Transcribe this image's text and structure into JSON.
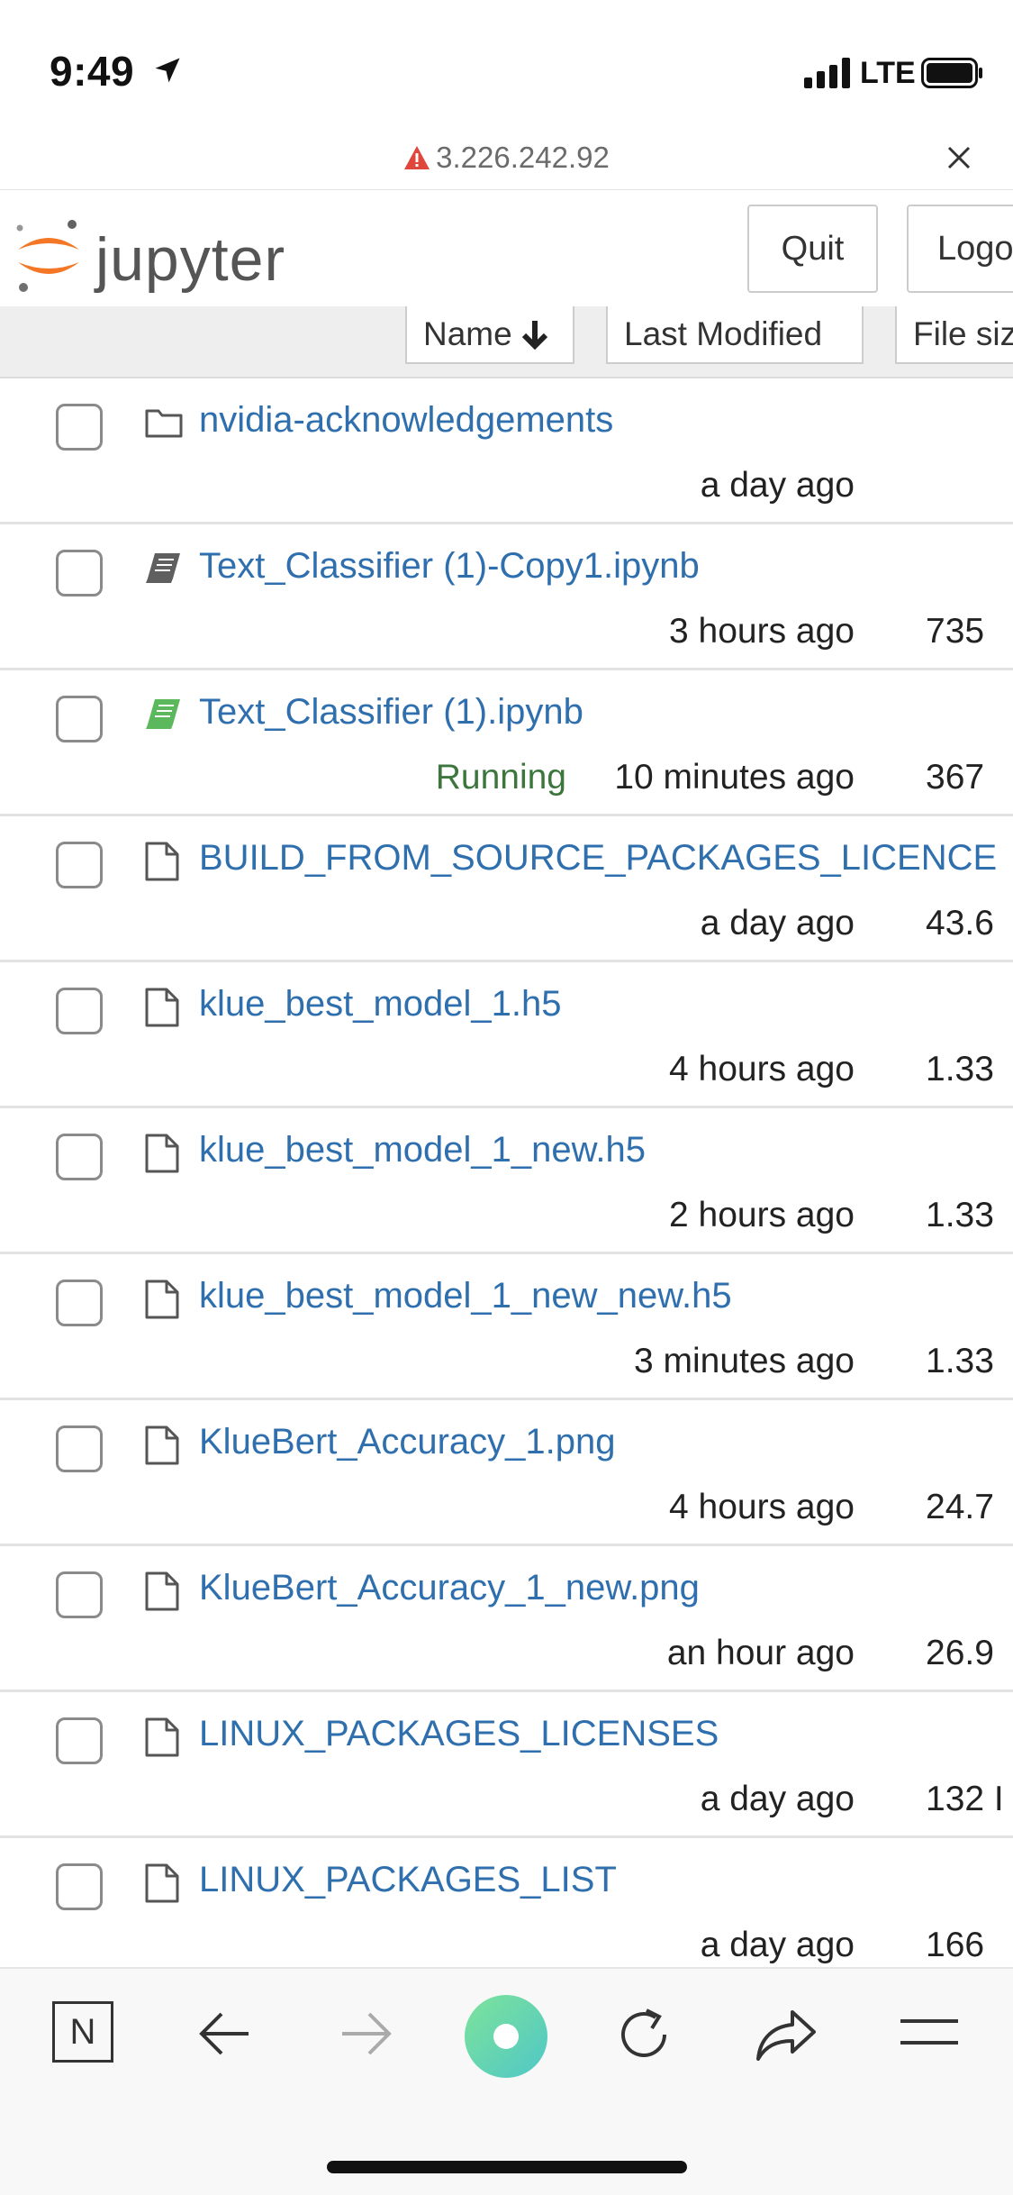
{
  "status_bar": {
    "time": "9:49",
    "network": "LTE"
  },
  "url_bar": {
    "url": "3.226.242.92"
  },
  "header": {
    "logo_text": "jupyter",
    "quit_label": "Quit",
    "logout_label": "Logo"
  },
  "sort": {
    "name_label": "Name",
    "modified_label": "Last Modified",
    "size_label": "File siz"
  },
  "files": [
    {
      "name": "nvidia-acknowledgements",
      "type": "folder",
      "modified": "a day ago",
      "size": "",
      "status": ""
    },
    {
      "name": "Text_Classifier (1)-Copy1.ipynb",
      "type": "notebook",
      "modified": "3 hours ago",
      "size": "735",
      "status": ""
    },
    {
      "name": "Text_Classifier (1).ipynb",
      "type": "notebook-running",
      "modified": "10 minutes ago",
      "size": "367",
      "status": "Running"
    },
    {
      "name": "BUILD_FROM_SOURCE_PACKAGES_LICENCE",
      "type": "file",
      "modified": "a day ago",
      "size": "43.6",
      "status": ""
    },
    {
      "name": "klue_best_model_1.h5",
      "type": "file",
      "modified": "4 hours ago",
      "size": "1.33",
      "status": ""
    },
    {
      "name": "klue_best_model_1_new.h5",
      "type": "file",
      "modified": "2 hours ago",
      "size": "1.33",
      "status": ""
    },
    {
      "name": "klue_best_model_1_new_new.h5",
      "type": "file",
      "modified": "3 minutes ago",
      "size": "1.33",
      "status": ""
    },
    {
      "name": "KlueBert_Accuracy_1.png",
      "type": "file",
      "modified": "4 hours ago",
      "size": "24.7",
      "status": ""
    },
    {
      "name": "KlueBert_Accuracy_1_new.png",
      "type": "file",
      "modified": "an hour ago",
      "size": "26.9",
      "status": ""
    },
    {
      "name": "LINUX_PACKAGES_LICENSES",
      "type": "file",
      "modified": "a day ago",
      "size": "132 I",
      "status": ""
    },
    {
      "name": "LINUX_PACKAGES_LIST",
      "type": "file",
      "modified": "a day ago",
      "size": "166",
      "status": ""
    }
  ],
  "toolbar": {
    "tab_label": "N"
  },
  "colors": {
    "link": "#2f6fae",
    "running": "#3c763d",
    "jupyter_orange": "#f37726"
  }
}
